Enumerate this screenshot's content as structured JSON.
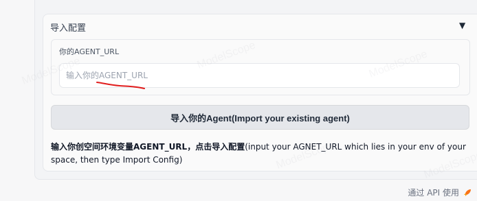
{
  "panel": {
    "title": "导入配置",
    "toggle_glyph": "▼"
  },
  "agent_url": {
    "label": "你的AGENT_URL",
    "placeholder": "输入你的AGENT_URL",
    "value": ""
  },
  "import_button": {
    "label": "导入你的Agent(Import your existing agent)"
  },
  "description": {
    "bold_part": "输入你创空间环境变量AGENT_URL，点击导入配置",
    "normal_part": "(input your AGNET_URL which lies in your env of your space, then type Import Config)"
  },
  "footer": {
    "api_text": "通过 API 使用"
  },
  "watermark": {
    "text": "ModelScope"
  },
  "colors": {
    "annotation_red": "#e11d1d",
    "footer_rocket": "#f97316"
  }
}
